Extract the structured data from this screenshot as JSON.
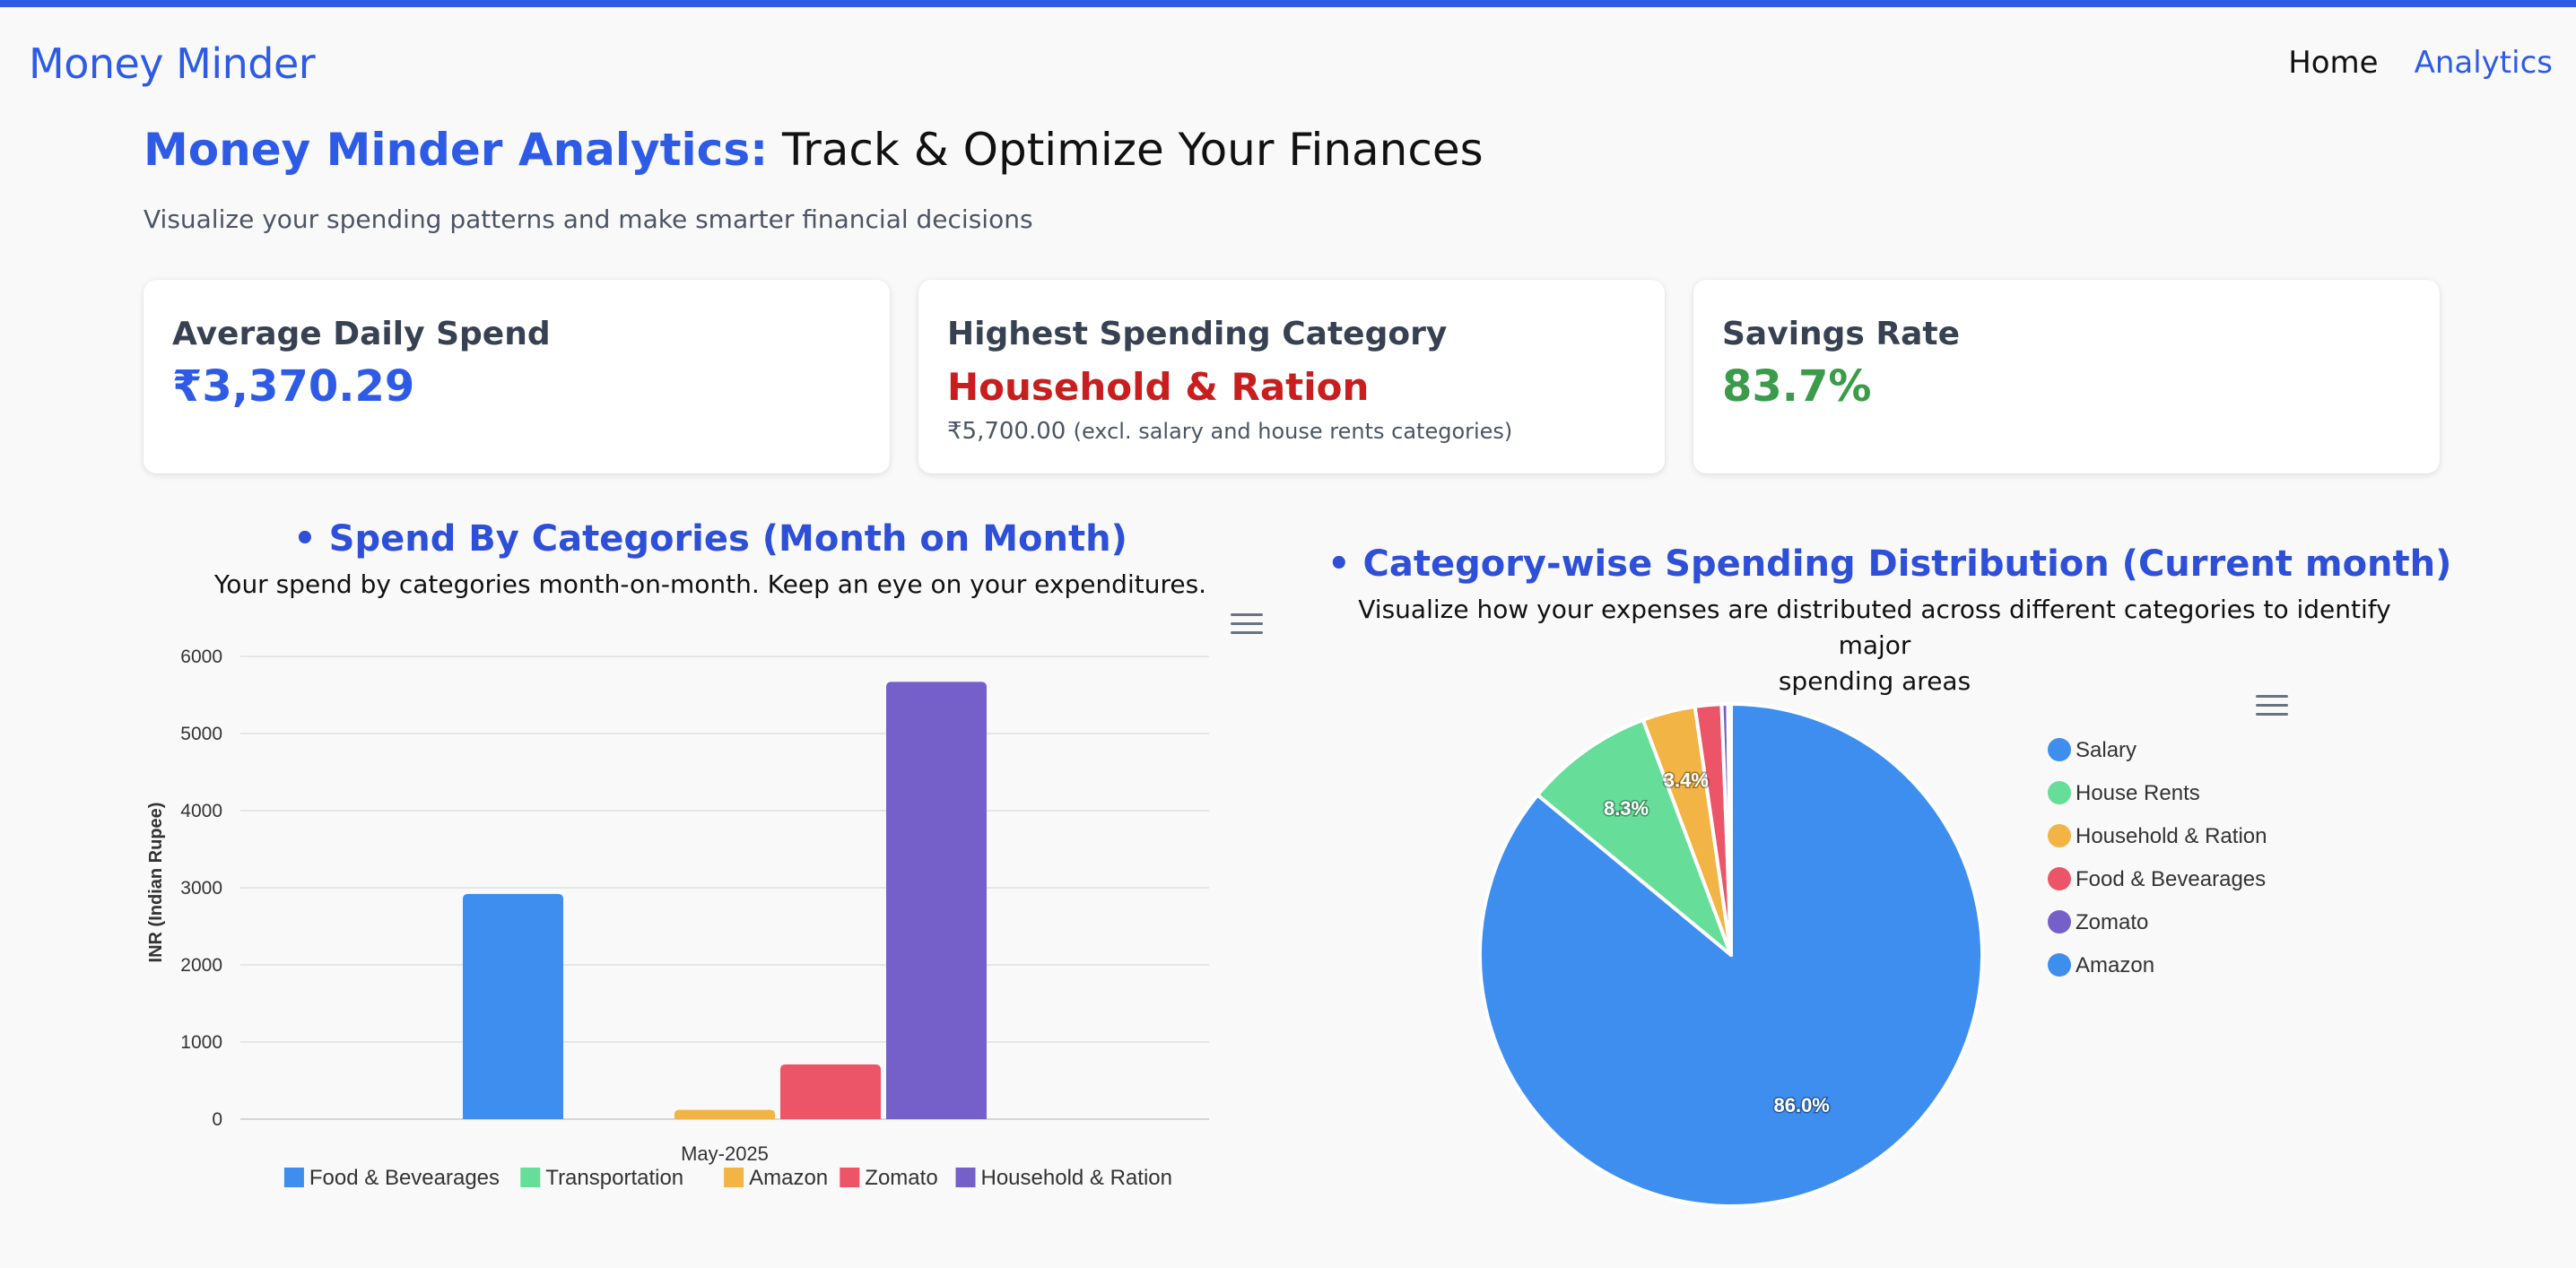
{
  "app": {
    "brand": "Money Minder"
  },
  "nav": {
    "home": "Home",
    "analytics": "Analytics"
  },
  "header": {
    "title_accent": "Money Minder Analytics:",
    "title_rest": "Track & Optimize Your Finances",
    "subtitle": "Visualize your spending patterns and make smarter financial decisions"
  },
  "cards": {
    "avg": {
      "label": "Average Daily Spend",
      "value": "₹3,370.29"
    },
    "highest": {
      "label": "Highest Spending Category",
      "value": "Household & Ration",
      "amount": "₹5,700.00",
      "note": "(excl. salary and house rents categories)"
    },
    "savings": {
      "label": "Savings Rate",
      "value": "83.7%"
    }
  },
  "bar_section": {
    "title": "• Spend By Categories (Month on Month)",
    "desc": "Your spend by categories month-on-month. Keep an eye on your expenditures."
  },
  "pie_section": {
    "title": "• Category-wise Spending Distribution (Current month)",
    "desc_line1": "Visualize how your expenses are distributed across different categories to identify major",
    "desc_line2": "spending areas"
  },
  "colors": {
    "accent": "#2e5be6",
    "blue": "#3e8eef",
    "green": "#66dd99",
    "orange": "#f2b445",
    "red": "#eb5567",
    "purple": "#7460c8"
  },
  "icons": {
    "menu": "hamburger-menu-icon"
  },
  "chart_data": [
    {
      "type": "bar",
      "title": "Spend By Categories (Month on Month)",
      "categories": [
        "May-2025"
      ],
      "ylabel": "INR (Indian Rupee)",
      "xlabel": "",
      "ylim": [
        0,
        6000
      ],
      "yticks": [
        "0",
        "1000",
        "2000",
        "3000",
        "4000",
        "5000",
        "6000"
      ],
      "grid": true,
      "legend_position": "bottom",
      "series": [
        {
          "name": "Food & Bevearages",
          "values": [
            2920
          ],
          "color": "#3e8eef"
        },
        {
          "name": "Transportation",
          "values": [
            0
          ],
          "color": "#66dd99"
        },
        {
          "name": "Amazon",
          "values": [
            120
          ],
          "color": "#f2b445"
        },
        {
          "name": "Zomato",
          "values": [
            710
          ],
          "color": "#eb5567"
        },
        {
          "name": "Household & Ration",
          "values": [
            5670
          ],
          "color": "#7460c8"
        }
      ]
    },
    {
      "type": "pie",
      "title": "Category-wise Spending Distribution (Current month)",
      "legend_position": "right",
      "slices": [
        {
          "name": "Salary",
          "value": 86.0,
          "label": "86.0%",
          "color": "#3e8eef"
        },
        {
          "name": "House Rents",
          "value": 8.3,
          "label": "8.3%",
          "color": "#66dd99"
        },
        {
          "name": "Household & Ration",
          "value": 3.4,
          "label": "3.4%",
          "color": "#f2b445"
        },
        {
          "name": "Food & Bevearages",
          "value": 1.7,
          "label": "",
          "color": "#eb5567"
        },
        {
          "name": "Zomato",
          "value": 0.4,
          "label": "",
          "color": "#7460c8"
        },
        {
          "name": "Amazon",
          "value": 0.2,
          "label": "",
          "color": "#3e8eef"
        }
      ]
    }
  ]
}
